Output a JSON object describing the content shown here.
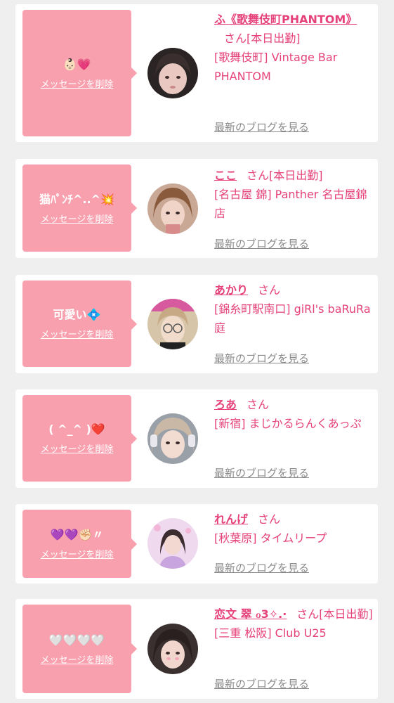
{
  "common": {
    "delete_label": "メッセージを削除",
    "blog_label": "最新のブログを見る"
  },
  "colors": {
    "accent_pink": "#e5417a",
    "bubble_pink": "#f9a0ae",
    "link_gray": "#8a8a8a"
  },
  "cards": [
    {
      "message": "👶🏻💗",
      "name": "ふ《歌舞伎町PHANTOM》",
      "san": "さん[本日出勤]",
      "shop": "[歌舞伎町] Vintage Bar PHANTOM",
      "avatar_icon": "profile-photo"
    },
    {
      "message": "猫ﾊﾟﾝﾁ^..^💥",
      "name": "ここ",
      "san": "さん[本日出勤]",
      "shop": "[名古屋 錦] Panther 名古屋錦店",
      "avatar_icon": "profile-photo"
    },
    {
      "message": "可愛い💠",
      "name": "あかり",
      "san": "さん",
      "shop": "[錦糸町駅南口] giRl's baRuRa庭",
      "avatar_icon": "profile-photo"
    },
    {
      "message": "( ^_^ )❤️",
      "name": "ろあ",
      "san": "さん",
      "shop": "[新宿] まじかるらんくあっぷ",
      "avatar_icon": "profile-photo"
    },
    {
      "message": "💜💜✊🏻〃",
      "name": "れんげ",
      "san": "さん",
      "shop": "[秋葉原] タイムリープ",
      "avatar_icon": "profile-photo"
    },
    {
      "message": "🤍🤍🤍🤍",
      "name": "恋文 翠 ℴ3✧.·",
      "san": "さん[本日出勤]",
      "shop": "[三重 松阪] Club U25",
      "avatar_icon": "profile-photo"
    }
  ]
}
